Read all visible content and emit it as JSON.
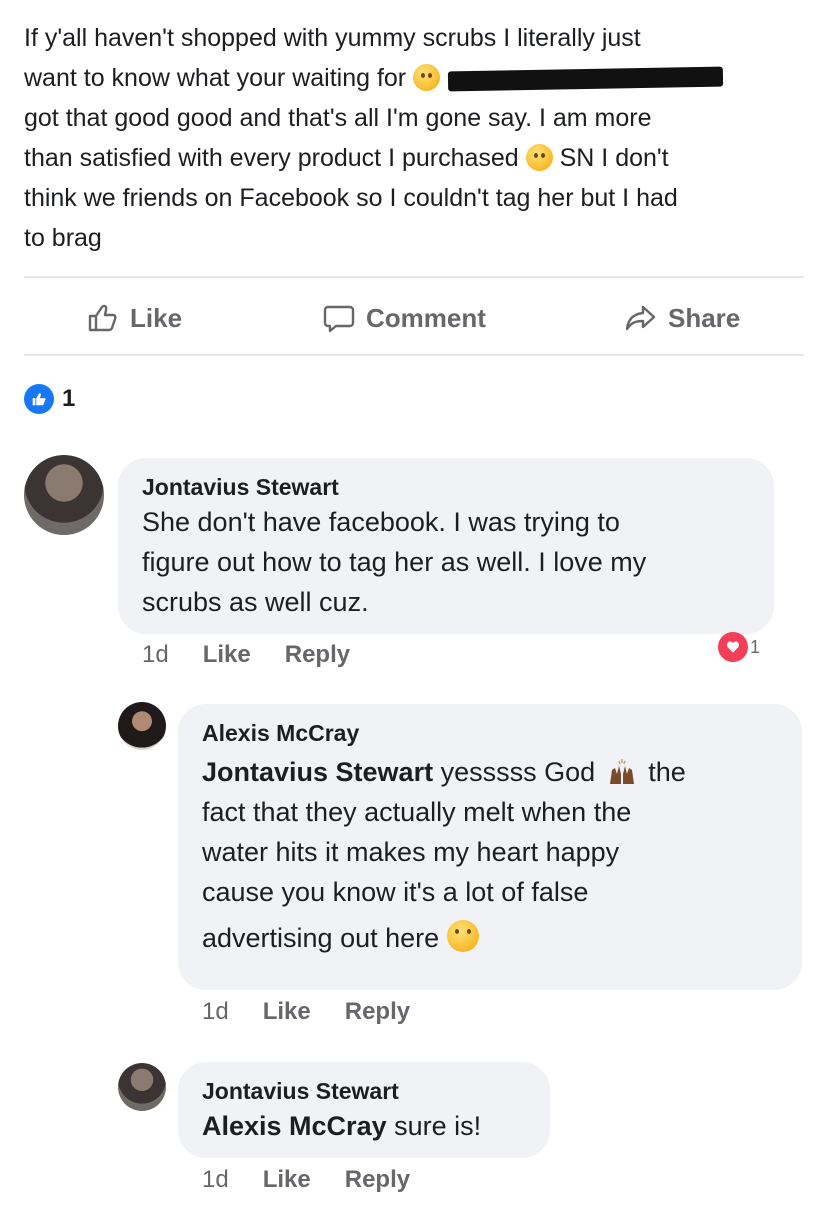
{
  "post": {
    "line1": "If y'all haven't shopped with yummy scrubs I literally just",
    "line2": "want to know what your waiting for",
    "line3": "got that good good and that's all I'm gone say. I am more",
    "line4a": "than satisfied with every product I purchased",
    "line4b": "SN I don't",
    "line5": "think we friends on Facebook so I couldn't tag her but I had",
    "line6": "to brag"
  },
  "actions": {
    "like": "Like",
    "comment": "Comment",
    "share": "Share"
  },
  "reactions": {
    "count": "1"
  },
  "comments": [
    {
      "author": "Jontavius Stewart",
      "line1": "She don't have facebook. I was trying to",
      "line2": "figure out how to tag her as well. I love my",
      "line3": "scrubs as well cuz.",
      "time": "1d",
      "like": "Like",
      "reply": "Reply",
      "heart_count": "1"
    },
    {
      "author": "Alexis McCray",
      "mention": "Jontavius Stewart",
      "line1a": "yesssss God",
      "line1b": "the",
      "line2": "fact that they actually melt when the",
      "line3": "water hits it makes my heart happy",
      "line4": "cause you know it's a lot of false",
      "line5": "advertising out here",
      "time": "1d",
      "like": "Like",
      "reply": "Reply"
    },
    {
      "author": "Jontavius Stewart",
      "mention": "Alexis McCray",
      "text": "sure is!",
      "time": "1d",
      "like": "Like",
      "reply": "Reply"
    }
  ],
  "colors": {
    "accent": "#1877f2",
    "heart": "#f33e58",
    "muted_text": "#65676b",
    "bubble": "#f0f2f5"
  },
  "icons": [
    "thumbs-up-icon",
    "comment-icon",
    "share-icon",
    "like-badge-icon",
    "heart-badge-icon",
    "emoji-icon",
    "raised-hands-icon"
  ]
}
